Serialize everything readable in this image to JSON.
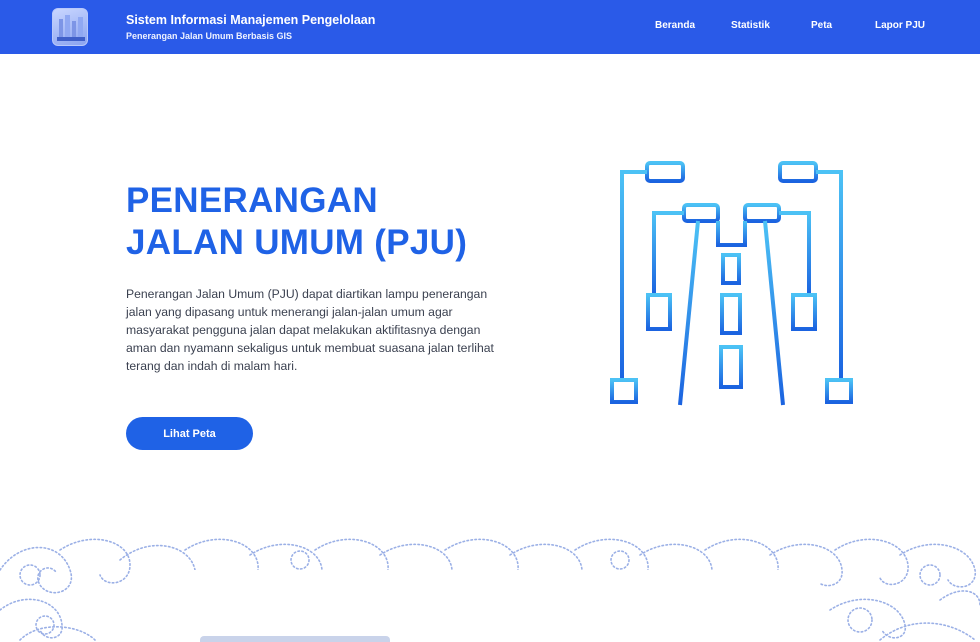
{
  "header": {
    "title": "Sistem Informasi Manajemen Pengelolaan",
    "subtitle": "Penerangan Jalan Umum Berbasis GIS",
    "nav": [
      {
        "label": "Beranda"
      },
      {
        "label": "Statistik"
      },
      {
        "label": "Peta"
      },
      {
        "label": "Lapor PJU"
      }
    ]
  },
  "hero": {
    "title_line1": "PENERANGAN",
    "title_line2": "JALAN UMUM (PJU)",
    "description": "Penerangan Jalan Umum (PJU) dapat diartikan lampu penerangan jalan yang dipasang untuk menerangi jalan-jalan umum agar masyarakat pengguna jalan dapat melakukan aktifitasnya dengan aman dan nyamann sekaligus untuk membuat suasana jalan terlihat terang dan indah di malam hari.",
    "button_label": "Lihat Peta"
  },
  "icons": {
    "logo": "city-logo-icon",
    "illustration": "street-lamp-road-icon",
    "decoration": "batik-ornament"
  },
  "colors": {
    "primary": "#2a5ae8",
    "accent": "#1f62e6",
    "illustration_top": "#4cc2f5",
    "illustration_bottom": "#1b63e0"
  }
}
